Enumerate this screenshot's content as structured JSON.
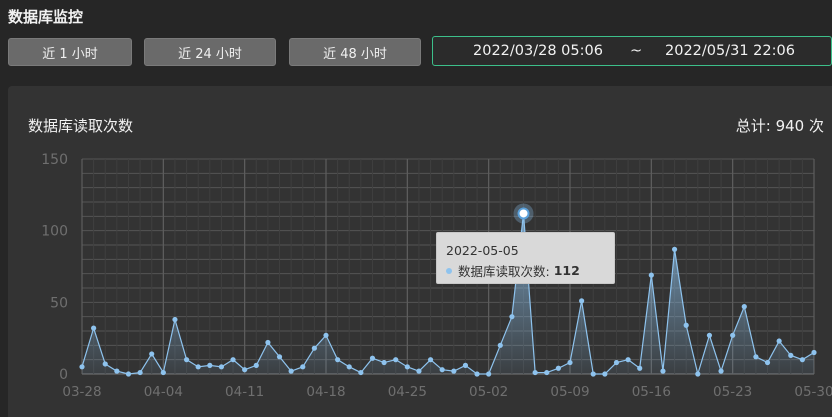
{
  "page_title": "数据库监控",
  "range_buttons": [
    {
      "label": "近 1 小时"
    },
    {
      "label": "近 24 小时"
    },
    {
      "label": "近 48 小时"
    }
  ],
  "date_range": {
    "start": "2022/03/28 05:06",
    "separator": "~",
    "end": "2022/05/31 22:06"
  },
  "chart_panel": {
    "title": "数据库读取次数",
    "total_label": "总计:",
    "total_value": "940 次"
  },
  "tooltip": {
    "date": "2022-05-05",
    "series": "数据库读取次数:",
    "value": "112"
  },
  "colors": {
    "line": "#8ec3ee",
    "accent_border": "#3cbf8a",
    "grid": "#555555"
  },
  "chart_data": {
    "type": "area",
    "title": "",
    "xlabel": "",
    "ylabel": "",
    "ylim": [
      0,
      150
    ],
    "yticks": [
      0,
      50,
      100,
      150
    ],
    "x_tick_labels": [
      "03-28",
      "04-04",
      "04-11",
      "04-18",
      "04-25",
      "05-02",
      "05-09",
      "05-16",
      "05-23",
      "05-30"
    ],
    "x_start": "2022-03-28",
    "x_end": "2022-05-31",
    "highlight": {
      "x": "2022-05-05",
      "y": 112
    },
    "series": [
      {
        "values": [
          5,
          32,
          7,
          2,
          0,
          1,
          14,
          1,
          38,
          10,
          5,
          6,
          5,
          10,
          3,
          6,
          22,
          12,
          2,
          5,
          18,
          27,
          10,
          5,
          1,
          11,
          8,
          10,
          5,
          2,
          10,
          3,
          2,
          6,
          0,
          0,
          20,
          40,
          112,
          1,
          1,
          4,
          8,
          51,
          0,
          0,
          8,
          10,
          4,
          69,
          2,
          87,
          34,
          0,
          27,
          2,
          27,
          47,
          12,
          8,
          23,
          13,
          10,
          15
        ]
      }
    ]
  }
}
